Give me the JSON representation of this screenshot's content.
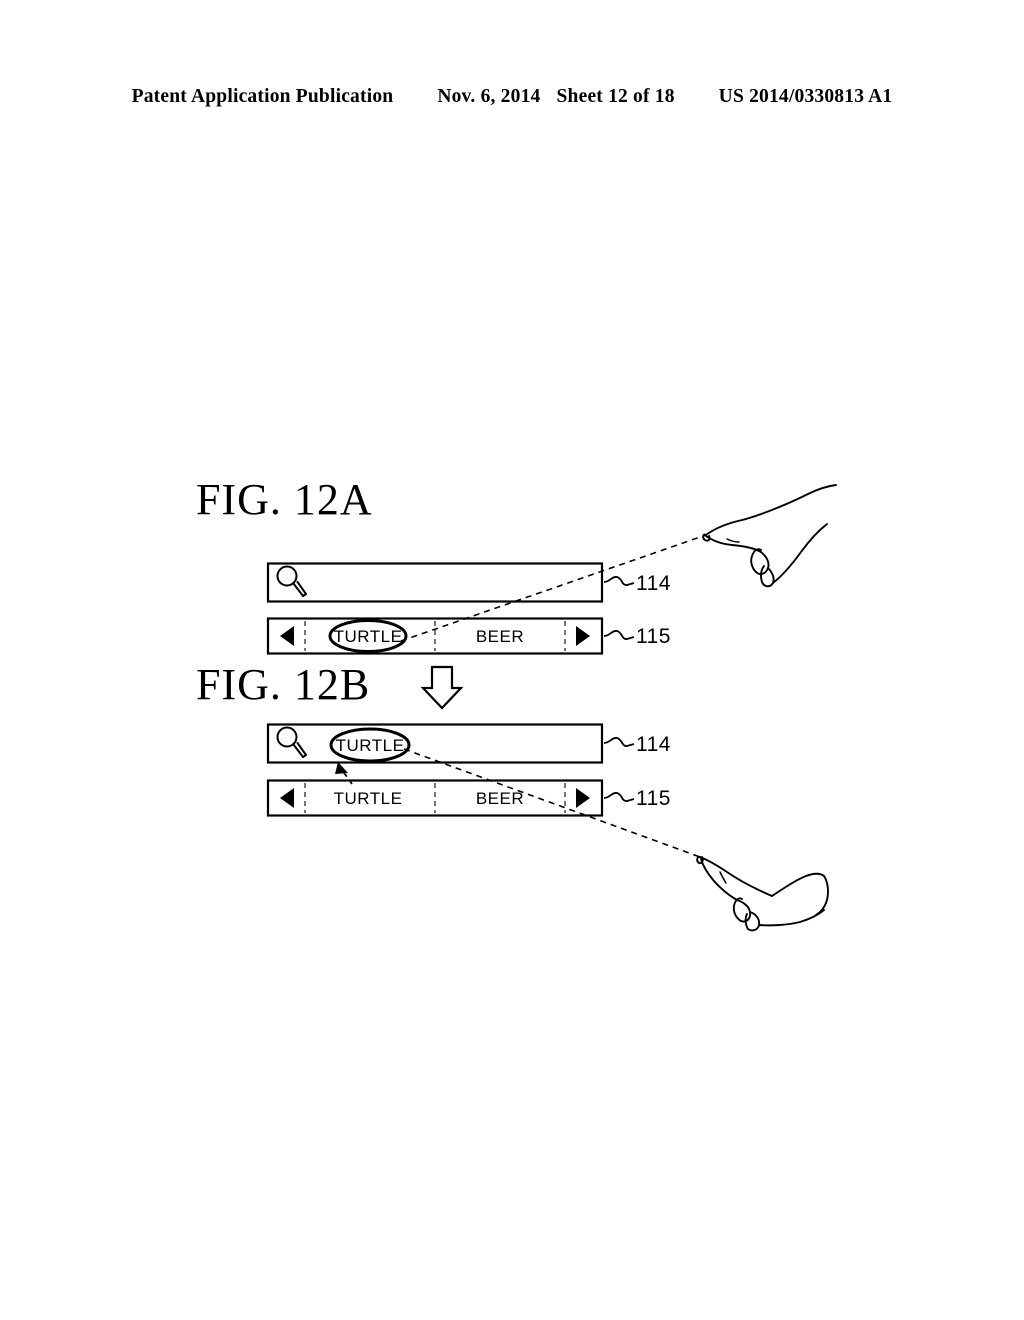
{
  "header": {
    "publication": "Patent Application Publication",
    "date": "Nov. 6, 2014",
    "sheet": "Sheet 12 of 18",
    "patent_number": "US 2014/0330813 A1"
  },
  "figures": [
    {
      "id": "fig-12a",
      "label": "FIG.  12A",
      "search_bar": {
        "ref": "114",
        "icon": "magnifier-icon",
        "value": ""
      },
      "tab_bar": {
        "ref": "115",
        "prev_icon": "left-triangle-icon",
        "next_icon": "right-triangle-icon",
        "tabs": [
          {
            "label": "TURTLE",
            "highlighted": true
          },
          {
            "label": "BEER",
            "highlighted": false
          }
        ]
      },
      "hand": {
        "name": "pointing-hand-icon",
        "gesture": "index-finger-point"
      },
      "pointer_line": "dashed"
    },
    {
      "id": "fig-12b",
      "label": "FIG.  12B",
      "transition_icon": "down-arrow-icon",
      "search_bar": {
        "ref": "114",
        "icon": "magnifier-icon",
        "value": "TURTLE",
        "highlighted": true
      },
      "tab_bar": {
        "ref": "115",
        "prev_icon": "left-triangle-icon",
        "next_icon": "right-triangle-icon",
        "tabs": [
          {
            "label": "TURTLE",
            "highlighted": false
          },
          {
            "label": "BEER",
            "highlighted": false
          }
        ]
      },
      "hand": {
        "name": "pointing-hand-icon",
        "gesture": "index-finger-point"
      },
      "pointer_line": "dashed",
      "move_arrow": "dashed-up-arrow"
    }
  ],
  "colors": {
    "ink": "#000000",
    "paper": "#ffffff",
    "divider": "#555555"
  }
}
